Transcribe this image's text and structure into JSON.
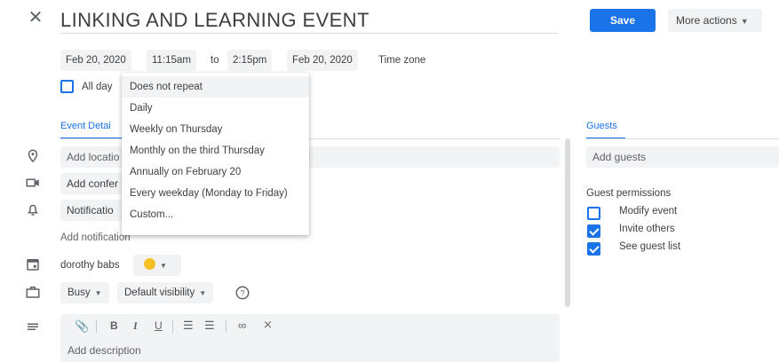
{
  "header": {
    "title": "LINKING AND LEARNING EVENT",
    "save_label": "Save",
    "more_actions_label": "More actions",
    "close_icon": "close-icon"
  },
  "datetime": {
    "start_date": "Feb 20, 2020",
    "start_time": "11:15am",
    "to_label": "to",
    "end_time": "2:15pm",
    "end_date": "Feb 20, 2020",
    "time_zone_label": "Time zone",
    "all_day_label": "All day",
    "all_day_checked": false
  },
  "repeat_menu": {
    "selected_index": 0,
    "options": [
      "Does not repeat",
      "Daily",
      "Weekly on Thursday",
      "Monthly on the third Thursday",
      "Annually on February 20",
      "Every weekday (Monday to Friday)",
      "Custom..."
    ]
  },
  "tabs": {
    "event_details": "Event Detai",
    "guests": "Guests"
  },
  "details": {
    "location_placeholder": "Add locatio",
    "conference_label": "Add confer",
    "notification_label": "Notificatio",
    "add_notification_label": "Add notification",
    "calendar_owner": "dorothy babs",
    "calendar_color": "#f6bf26",
    "busy_label": "Busy",
    "visibility_label": "Default visibility",
    "description_placeholder": "Add description"
  },
  "guests": {
    "add_guests_placeholder": "Add guests",
    "permissions_title": "Guest permissions",
    "permissions": [
      {
        "label": "Modify event",
        "checked": false
      },
      {
        "label": "Invite others",
        "checked": true
      },
      {
        "label": "See guest list",
        "checked": true
      }
    ]
  },
  "colors": {
    "accent": "#1a73e8",
    "field_bg": "#f1f3f4"
  }
}
